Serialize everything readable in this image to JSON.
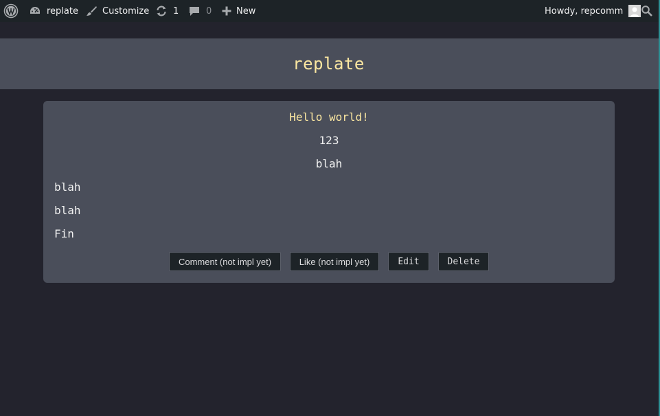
{
  "adminbar": {
    "wp_logo_icon": "wordpress-logo-icon",
    "site_name": "replate",
    "customize_label": "Customize",
    "updates_count": "1",
    "comments_count": "0",
    "new_label": "New",
    "howdy_text": "Howdy, repcomm",
    "search_icon": "search-icon"
  },
  "site": {
    "title": "replate"
  },
  "post": {
    "title": "Hello world!",
    "lines_centered": [
      "123",
      "blah"
    ],
    "lines_left": [
      "blah",
      "blah",
      "Fin"
    ],
    "buttons": {
      "comment": "Comment (not impl yet)",
      "like": "Like (not impl yet)",
      "edit": "Edit",
      "delete": "Delete"
    }
  },
  "colors": {
    "background": "#23232d",
    "panel": "#4a4e5a",
    "title_accent": "#fbe7a1",
    "adminbar": "#1d2327"
  }
}
